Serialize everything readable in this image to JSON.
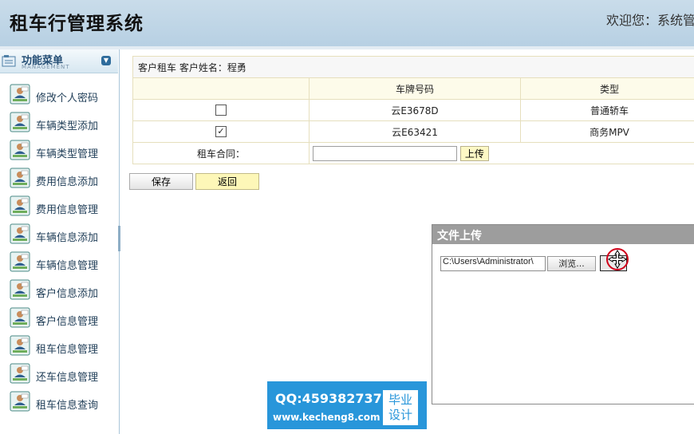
{
  "header": {
    "title": "租车行管理系统",
    "welcome": "欢迎您：系统管理员"
  },
  "sidebar": {
    "title": "功能菜单",
    "subtitle": "MANAGEMENT",
    "items": [
      {
        "label": "修改个人密码"
      },
      {
        "label": "车辆类型添加"
      },
      {
        "label": "车辆类型管理"
      },
      {
        "label": "费用信息添加"
      },
      {
        "label": "费用信息管理"
      },
      {
        "label": "车辆信息添加"
      },
      {
        "label": "车辆信息管理"
      },
      {
        "label": "客户信息添加"
      },
      {
        "label": "客户信息管理"
      },
      {
        "label": "租车信息管理"
      },
      {
        "label": "还车信息管理"
      },
      {
        "label": "租车信息查询"
      }
    ]
  },
  "form": {
    "caption": "客户租车  客户姓名：程勇",
    "columns": [
      "车牌号码",
      "类型"
    ],
    "rows": [
      {
        "checked": false,
        "plate": "云E3678D",
        "type": "普通轿车"
      },
      {
        "checked": true,
        "plate": "云E63421",
        "type": "商务MPV"
      }
    ],
    "contract_label": "租车合同：",
    "contract_value": "",
    "upload_label": "上传",
    "save_label": "保存",
    "back_label": "返回"
  },
  "dialog": {
    "title": "文件上传",
    "file_path": "C:\\Users\\Administrator\\",
    "browse_label": "浏览..."
  },
  "watermark": {
    "qq": "QQ:459382737",
    "site": "www.kecheng8.com",
    "badge_line1": "毕业",
    "badge_line2": "设计"
  },
  "colors": {
    "header_bg": "#c9dcea",
    "dialog_title_bg": "#9d9d9d",
    "watermark_bg": "#2896da",
    "back_btn_bg": "#fdf7b8"
  }
}
